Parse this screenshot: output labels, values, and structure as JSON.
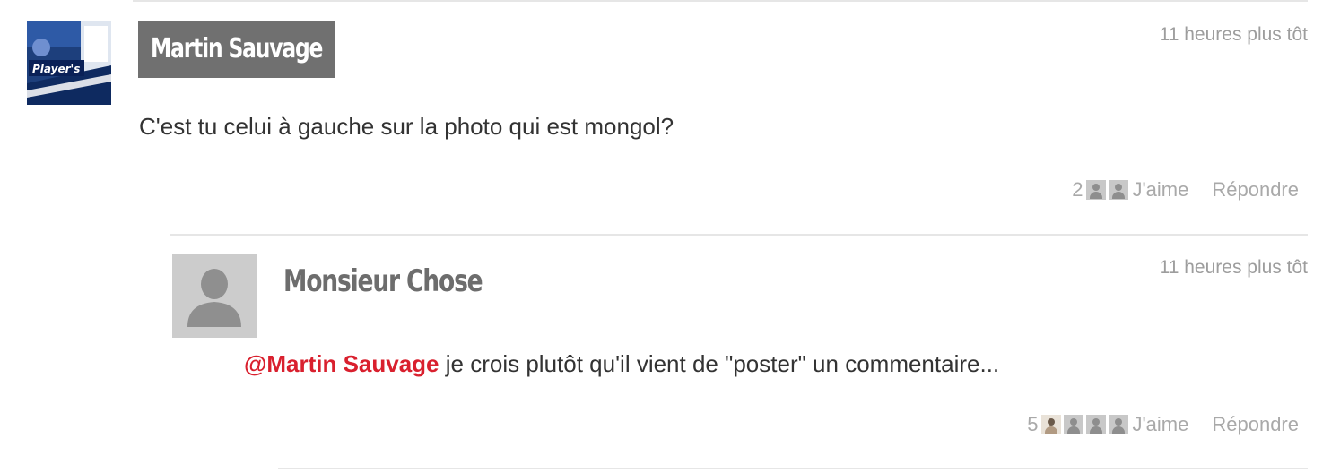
{
  "comments": [
    {
      "author": "Martin Sauvage",
      "time": "11 heures plus tôt",
      "text": "C'est tu celui à gauche sur la photo qui est mongol?",
      "like_count": "2",
      "like_label": "J'aime",
      "reply_label": "Répondre",
      "avatar_text": "Player's"
    },
    {
      "author": "Monsieur Chose",
      "time": "11 heures plus tôt",
      "mention": "@Martin Sauvage",
      "text": " je crois plutôt qu'il vient de \"poster\" un commentaire...",
      "like_count": "5",
      "like_label": "J'aime",
      "reply_label": "Répondre"
    }
  ],
  "colors": {
    "mention": "#d9202e",
    "author_tag_bg": "#707070",
    "muted": "#a9a9a9"
  }
}
